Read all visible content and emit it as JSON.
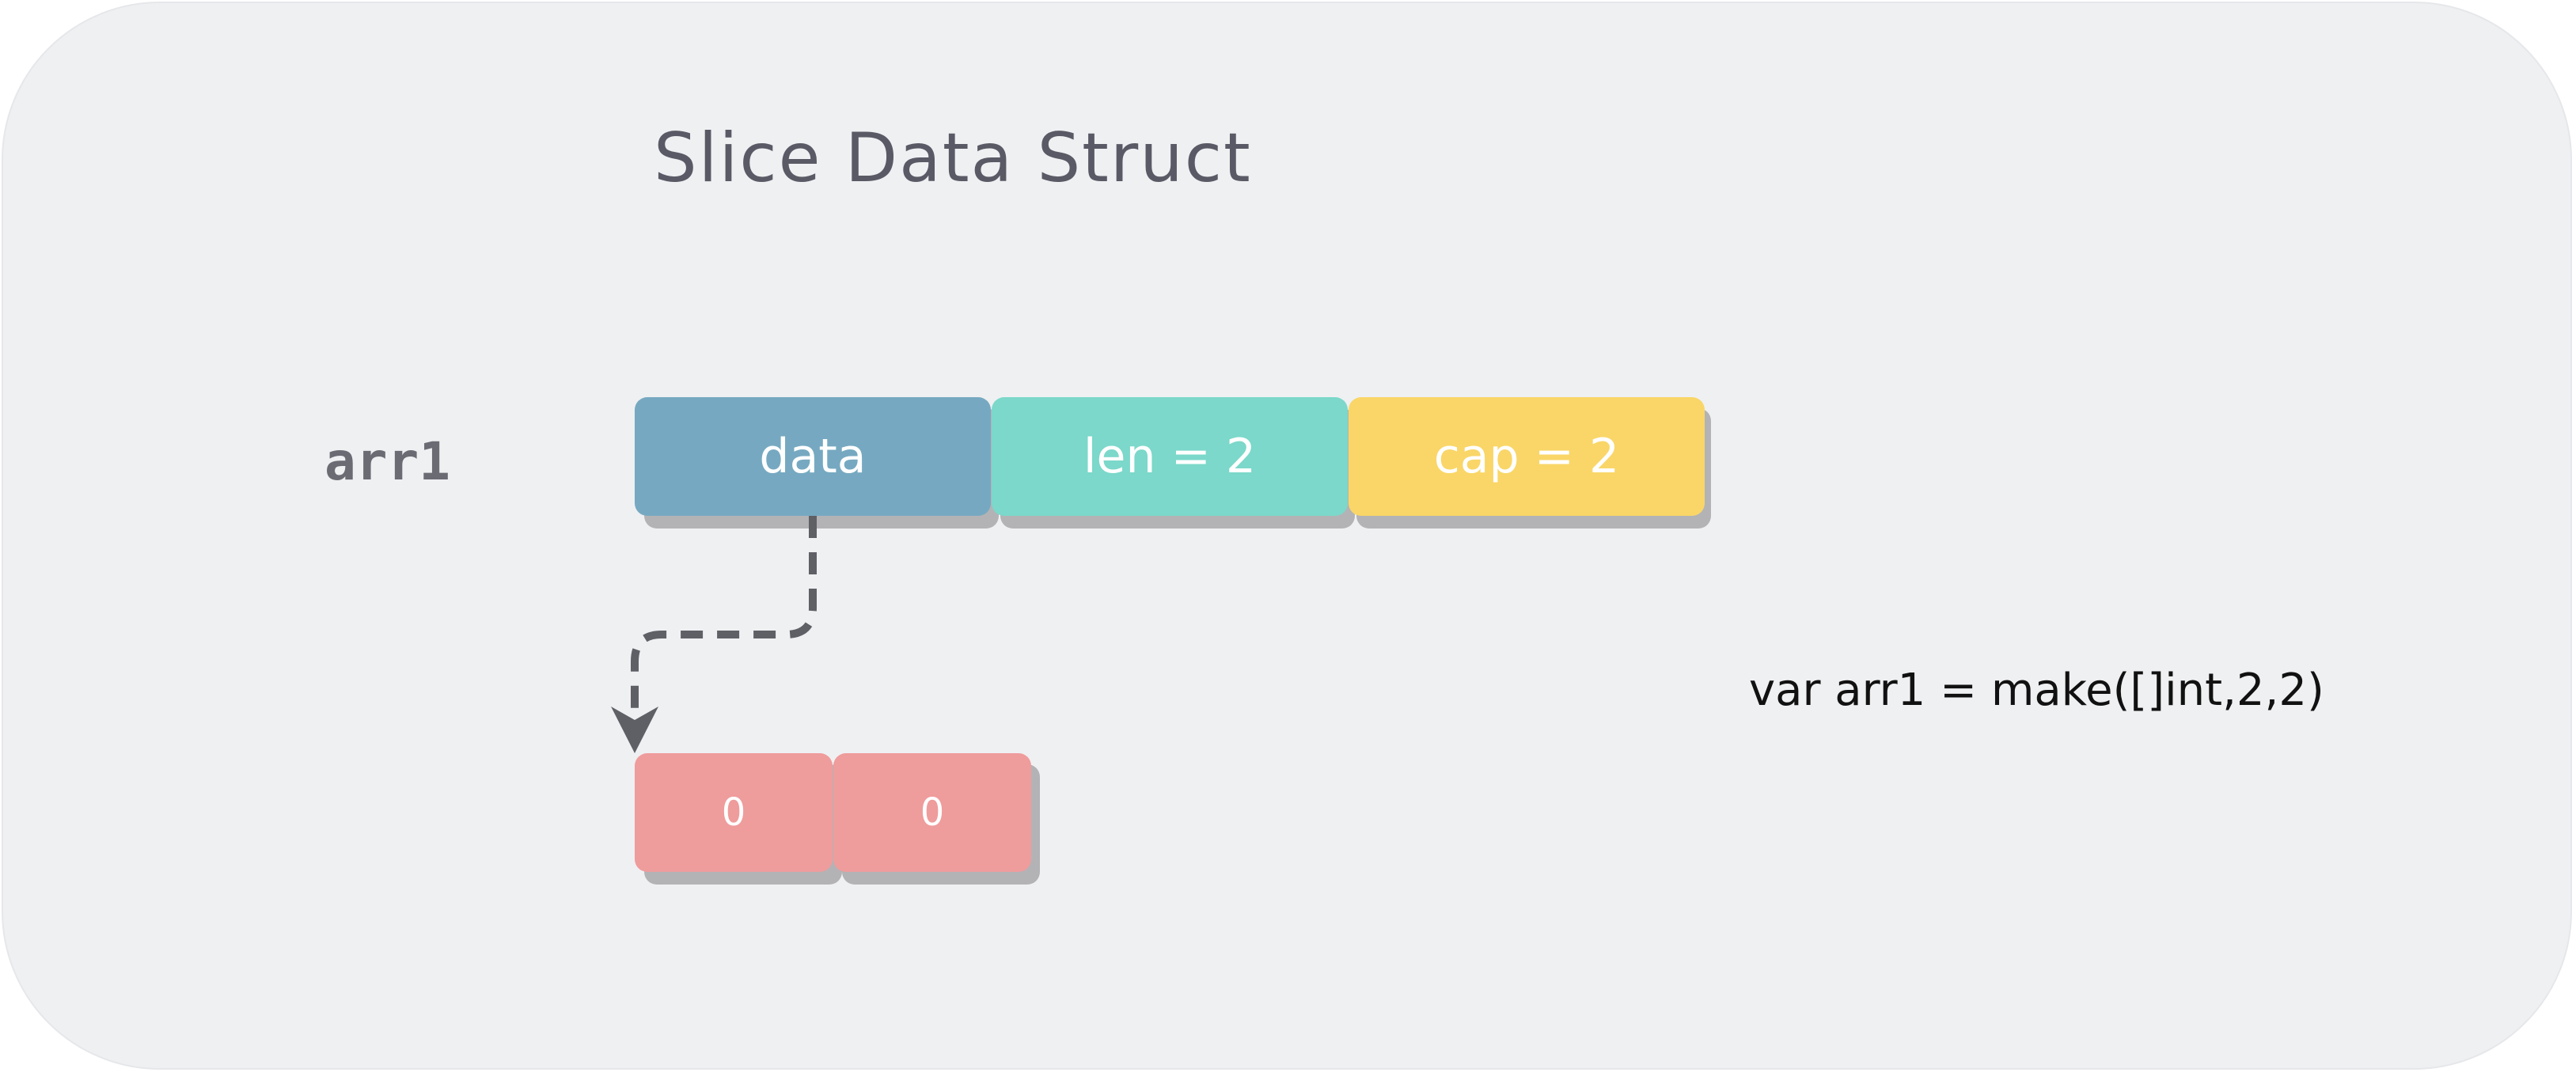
{
  "title": "Slice Data Struct",
  "variable": "arr1",
  "struct_fields": [
    {
      "label": "data",
      "color": "#76a9c1"
    },
    {
      "label": "len = 2",
      "color": "#7bd8ca"
    },
    {
      "label": "cap = 2",
      "color": "#f9d667"
    }
  ],
  "elements": [
    {
      "value": "0",
      "color": "#ef9c9c"
    },
    {
      "value": "0",
      "color": "#ef9c9c"
    }
  ],
  "code": "var arr1 = make([]int,2,2)",
  "colors": {
    "background": "#eff0f2",
    "shadow": "#b3b3b6",
    "arrow": "#5f5f66"
  }
}
